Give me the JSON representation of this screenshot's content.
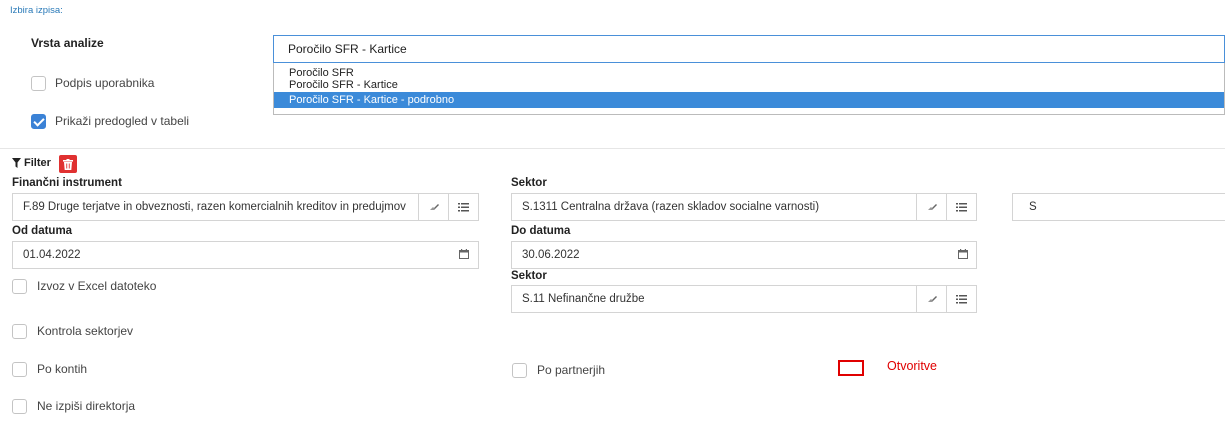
{
  "section_title": "Izbira izpisa:",
  "analysis": {
    "label": "Vrsta analize",
    "selected": "Poročilo SFR - Kartice",
    "options": [
      "Poročilo SFR",
      "Poročilo SFR - Kartice",
      "Poročilo SFR - Kartice - podrobno"
    ]
  },
  "checkboxes": {
    "podpis": "Podpis uporabnika",
    "predogled": "Prikaži predogled v tabeli",
    "excel": "Izvoz v Excel datoteko",
    "kontrola": "Kontrola sektorjev",
    "po_kontih": "Po kontih",
    "po_partnerjih": "Po partnerjih",
    "ne_izpisi": "Ne izpiši direktorja"
  },
  "filter": {
    "label": "Filter"
  },
  "fields": {
    "fin_label": "Finančni instrument",
    "fin_value": "F.89 Druge terjatve in obveznosti, razen komercialnih kreditov in predujmov",
    "sektor1_label": "Sektor",
    "sektor1_value": "S.1311 Centralna država (razen skladov socialne varnosti)",
    "sektor_extra_value": "S",
    "od_label": "Od datuma",
    "od_value": "01.04.2022",
    "do_label": "Do datuma",
    "do_value": "30.06.2022",
    "sektor2_label": "Sektor",
    "sektor2_value": "S.11 Nefinančne družbe"
  },
  "otvoritve_label": "Otvoritve",
  "colors": {
    "accent": "#3b82d6",
    "danger": "#e03131",
    "annotation": "#e00000"
  }
}
